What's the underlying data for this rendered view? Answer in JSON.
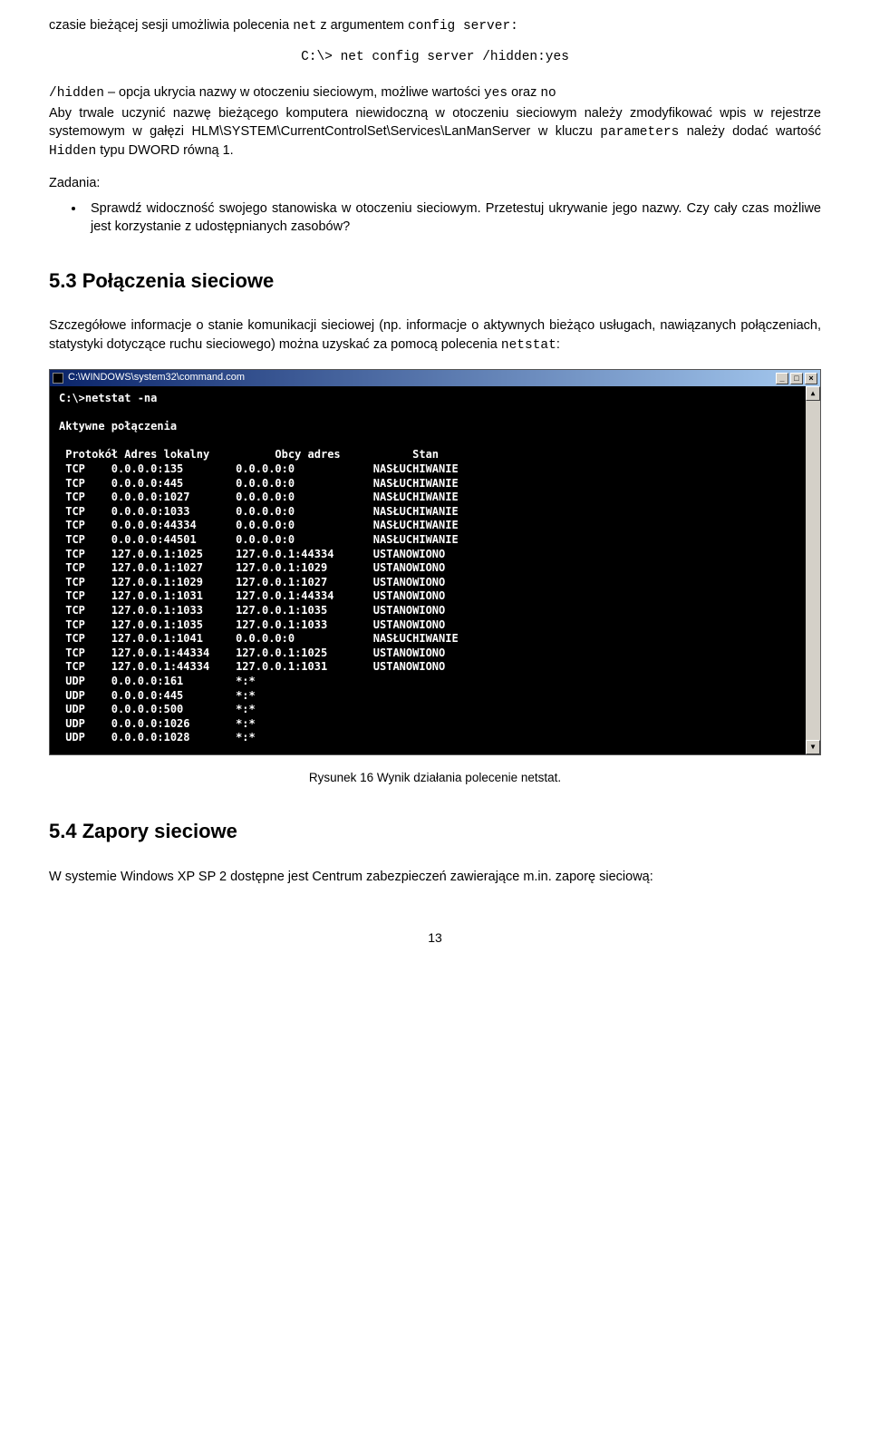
{
  "para1": {
    "t1": "czasie bieżącej sesji umożliwia  polecenia ",
    "code1": "net",
    "t2": " z argumentem ",
    "code2": "config server:"
  },
  "cmd_line": "C:\\> net config server /hidden:yes",
  "para2": {
    "code1": "/hidden",
    "t1": " – opcja ukrycia nazwy w otoczeniu sieciowym, możliwe wartości ",
    "code2": "yes",
    "t2": " oraz ",
    "code3": "no"
  },
  "para3": {
    "t1": "Aby trwale uczynić nazwę bieżącego komputera niewidoczną w otoczeniu sieciowym należy zmodyfikować wpis w rejestrze systemowym w gałęzi HLM\\SYSTEM\\CurrentControlSet\\Services\\LanManServer w kluczu ",
    "code1": "parameters",
    "t2": " należy dodać wartość ",
    "code2": "Hidden",
    "t3": " typu DWORD równą 1."
  },
  "tasks_label": "Zadania:",
  "task1": "Sprawdź widoczność swojego stanowiska w otoczeniu sieciowym. Przetestuj ukrywanie jego nazwy. Czy cały czas możliwe jest korzystanie z udostępnianych zasobów?",
  "sec53_title": "5.3  Połączenia sieciowe",
  "para53": {
    "t1": "Szczegółowe informacje o stanie komunikacji sieciowej (np. informacje o aktywnych bieżąco usługach, nawiązanych połączeniach, statystyki dotyczące ruchu sieciowego) można uzyskać za pomocą polecenia ",
    "code1": "netstat",
    "t2": ":"
  },
  "terminal": {
    "title": "C:\\WINDOWS\\system32\\command.com",
    "prompt": "C:\\>netstat -na",
    "active": "Aktywne połączenia",
    "hdr_proto": "Protokół",
    "hdr_local": "Adres lokalny",
    "hdr_foreign": "Obcy adres",
    "hdr_state": "Stan",
    "rows": [
      {
        "p": "TCP",
        "l": "0.0.0.0:135",
        "f": "0.0.0.0:0",
        "s": "NASŁUCHIWANIE"
      },
      {
        "p": "TCP",
        "l": "0.0.0.0:445",
        "f": "0.0.0.0:0",
        "s": "NASŁUCHIWANIE"
      },
      {
        "p": "TCP",
        "l": "0.0.0.0:1027",
        "f": "0.0.0.0:0",
        "s": "NASŁUCHIWANIE"
      },
      {
        "p": "TCP",
        "l": "0.0.0.0:1033",
        "f": "0.0.0.0:0",
        "s": "NASŁUCHIWANIE"
      },
      {
        "p": "TCP",
        "l": "0.0.0.0:44334",
        "f": "0.0.0.0:0",
        "s": "NASŁUCHIWANIE"
      },
      {
        "p": "TCP",
        "l": "0.0.0.0:44501",
        "f": "0.0.0.0:0",
        "s": "NASŁUCHIWANIE"
      },
      {
        "p": "TCP",
        "l": "127.0.0.1:1025",
        "f": "127.0.0.1:44334",
        "s": "USTANOWIONO"
      },
      {
        "p": "TCP",
        "l": "127.0.0.1:1027",
        "f": "127.0.0.1:1029",
        "s": "USTANOWIONO"
      },
      {
        "p": "TCP",
        "l": "127.0.0.1:1029",
        "f": "127.0.0.1:1027",
        "s": "USTANOWIONO"
      },
      {
        "p": "TCP",
        "l": "127.0.0.1:1031",
        "f": "127.0.0.1:44334",
        "s": "USTANOWIONO"
      },
      {
        "p": "TCP",
        "l": "127.0.0.1:1033",
        "f": "127.0.0.1:1035",
        "s": "USTANOWIONO"
      },
      {
        "p": "TCP",
        "l": "127.0.0.1:1035",
        "f": "127.0.0.1:1033",
        "s": "USTANOWIONO"
      },
      {
        "p": "TCP",
        "l": "127.0.0.1:1041",
        "f": "0.0.0.0:0",
        "s": "NASŁUCHIWANIE"
      },
      {
        "p": "TCP",
        "l": "127.0.0.1:44334",
        "f": "127.0.0.1:1025",
        "s": "USTANOWIONO"
      },
      {
        "p": "TCP",
        "l": "127.0.0.1:44334",
        "f": "127.0.0.1:1031",
        "s": "USTANOWIONO"
      },
      {
        "p": "UDP",
        "l": "0.0.0.0:161",
        "f": "*:*",
        "s": ""
      },
      {
        "p": "UDP",
        "l": "0.0.0.0:445",
        "f": "*:*",
        "s": ""
      },
      {
        "p": "UDP",
        "l": "0.0.0.0:500",
        "f": "*:*",
        "s": ""
      },
      {
        "p": "UDP",
        "l": "0.0.0.0:1026",
        "f": "*:*",
        "s": ""
      },
      {
        "p": "UDP",
        "l": "0.0.0.0:1028",
        "f": "*:*",
        "s": ""
      }
    ]
  },
  "fig_caption": "Rysunek 16 Wynik działania polecenie netstat.",
  "sec54_title": "5.4  Zapory sieciowe",
  "para54": "W systemie Windows XP SP 2 dostępne jest Centrum zabezpieczeń zawierające m.in. zaporę sieciową:",
  "page_number": "13"
}
